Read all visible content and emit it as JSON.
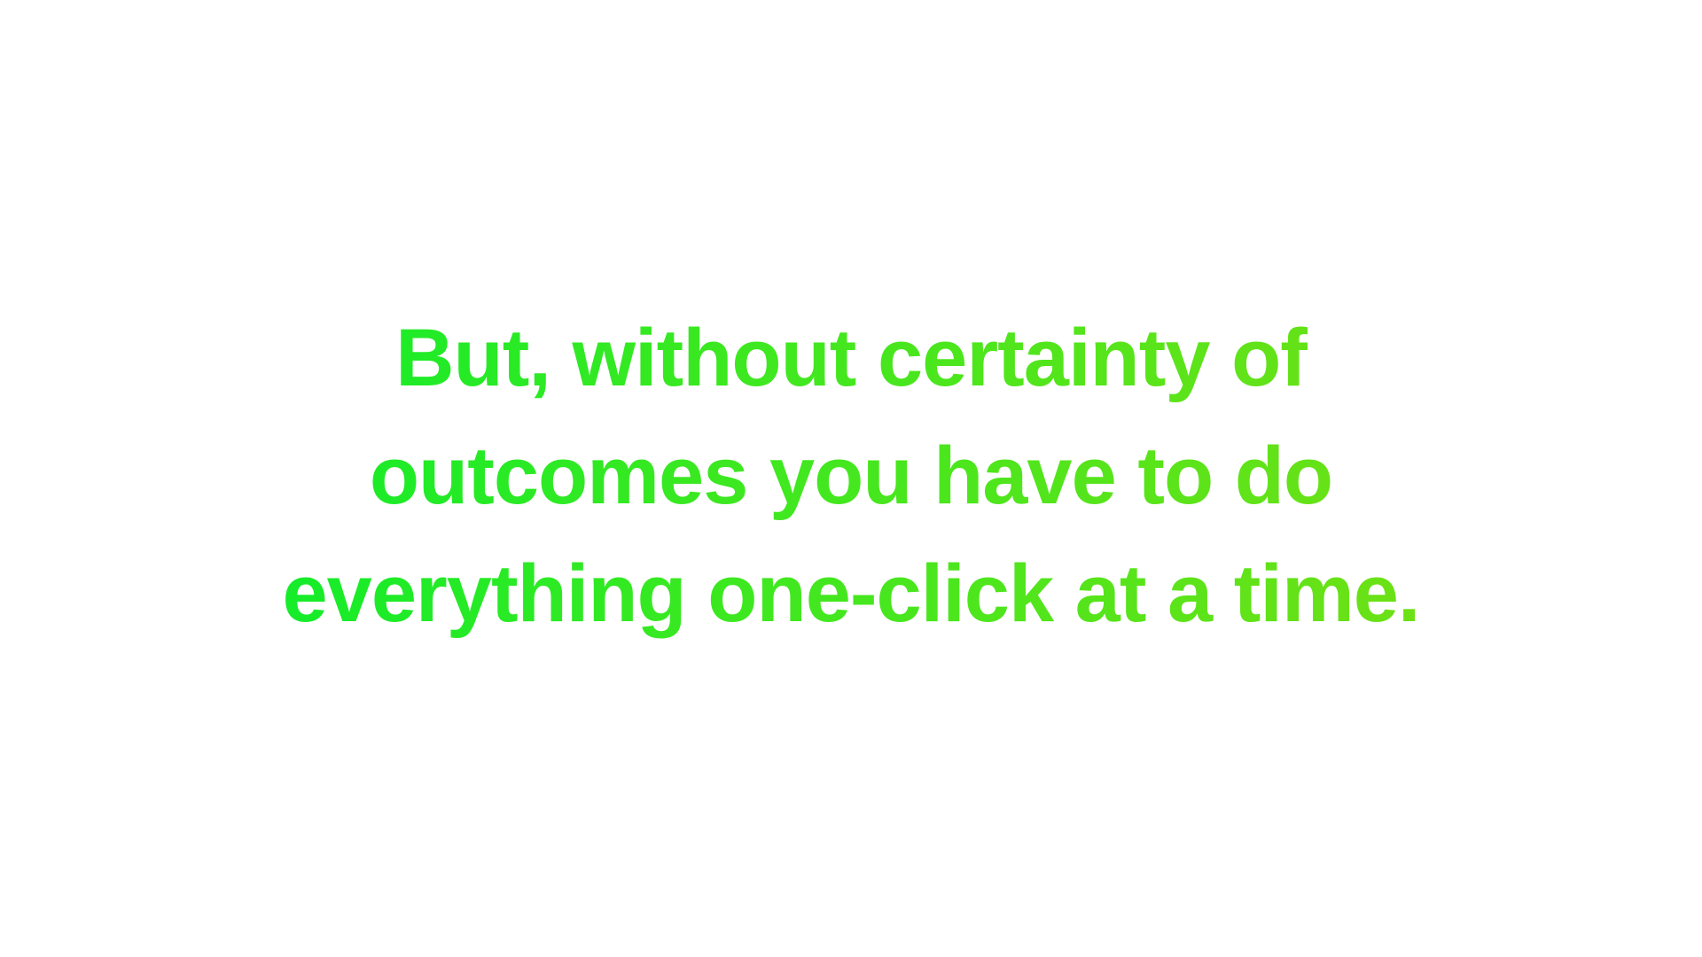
{
  "slide": {
    "lines": [
      "But, without certainty of",
      "outcomes you have to do",
      "everything one-click at a time."
    ]
  },
  "colors": {
    "background": "#ffffff",
    "text_start": "#15ec2a",
    "text_end": "#6ce116"
  }
}
